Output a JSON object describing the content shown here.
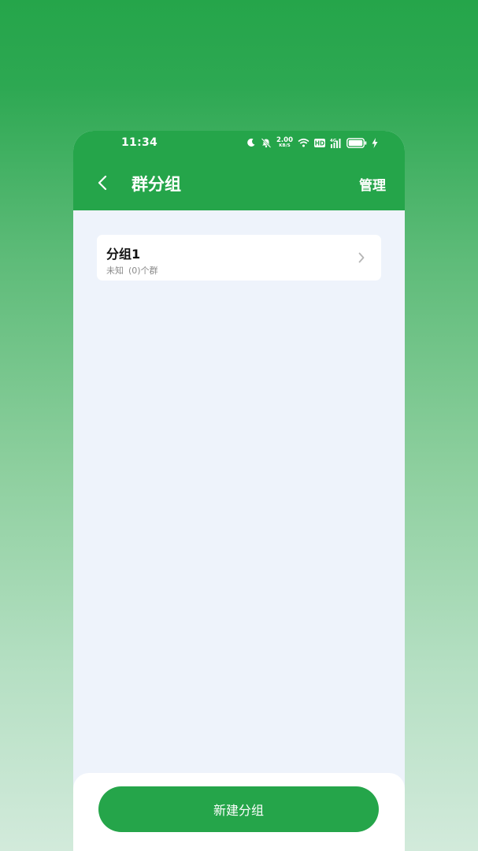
{
  "status_bar": {
    "time": "11:34",
    "net_speed_value": "2.00",
    "net_speed_unit": "KB/S",
    "hd_label": "HD",
    "signal_label": "4G",
    "icons": [
      "moon-icon",
      "mute-icon",
      "wifi-icon",
      "hd-icon",
      "signal-icon",
      "battery-icon",
      "charging-icon"
    ]
  },
  "header": {
    "title": "群分组",
    "manage_label": "管理",
    "back_icon": "chevron-left-icon"
  },
  "groups": [
    {
      "name": "分组1",
      "status": "未知",
      "count_text": "(0)个群"
    }
  ],
  "footer": {
    "new_group_label": "新建分组"
  },
  "colors": {
    "primary": "#25a54a",
    "content_bg": "#eef3fb",
    "card_bg": "#ffffff",
    "subtext": "#8a8a8a"
  }
}
